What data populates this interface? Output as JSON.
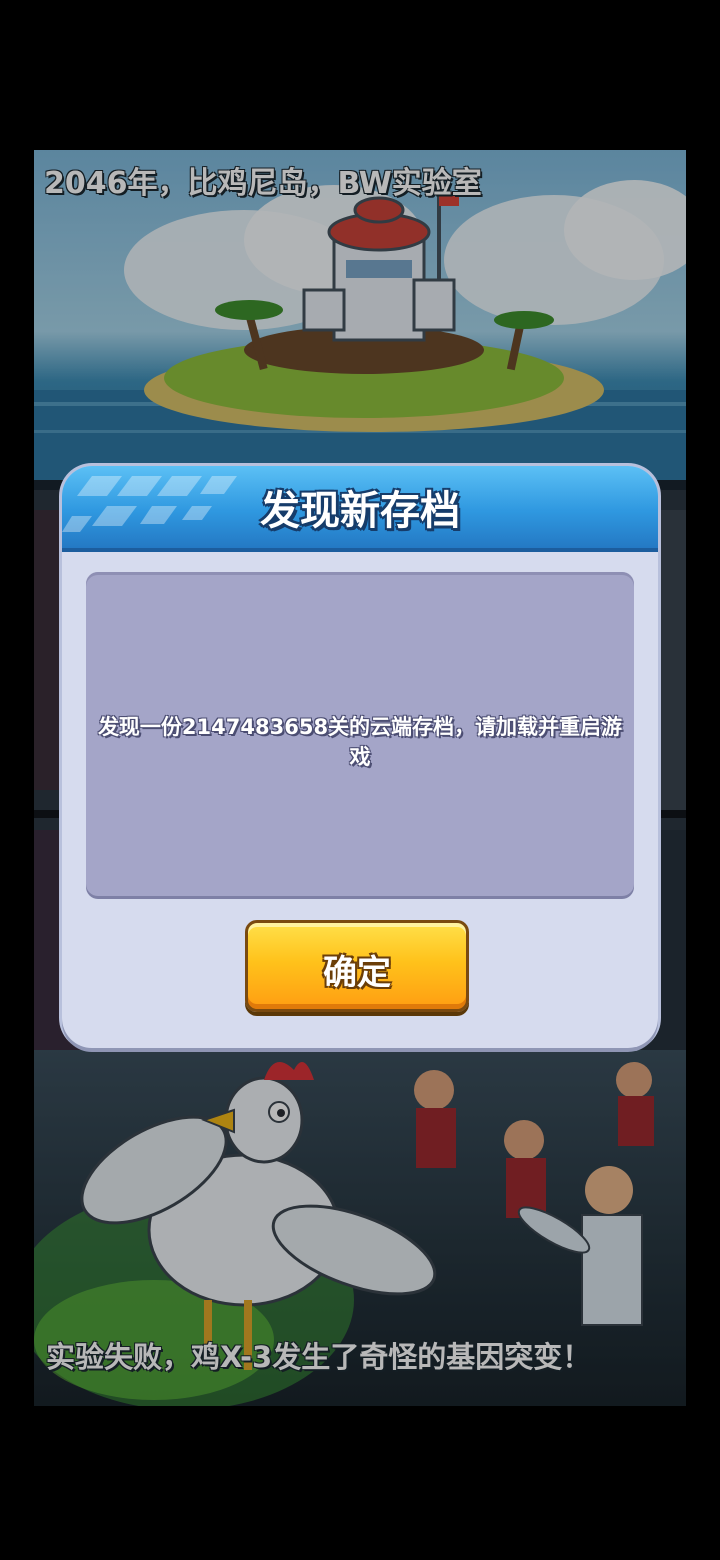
{
  "scene": {
    "caption_top": "2046年，比鸡尼岛，BW实验室",
    "caption_bottom": "实验失败，鸡X-3发生了奇怪的基因突变！"
  },
  "dialog": {
    "title": "发现新存档",
    "message": "发现一份2147483658关的云端存档，请加载并重启游戏",
    "confirm_label": "确定"
  },
  "colors": {
    "header_blue": "#2f98e0",
    "dialog_bg": "#d6dbee",
    "message_bg": "#a4a5c8",
    "button_orange": "#ffc21b"
  }
}
